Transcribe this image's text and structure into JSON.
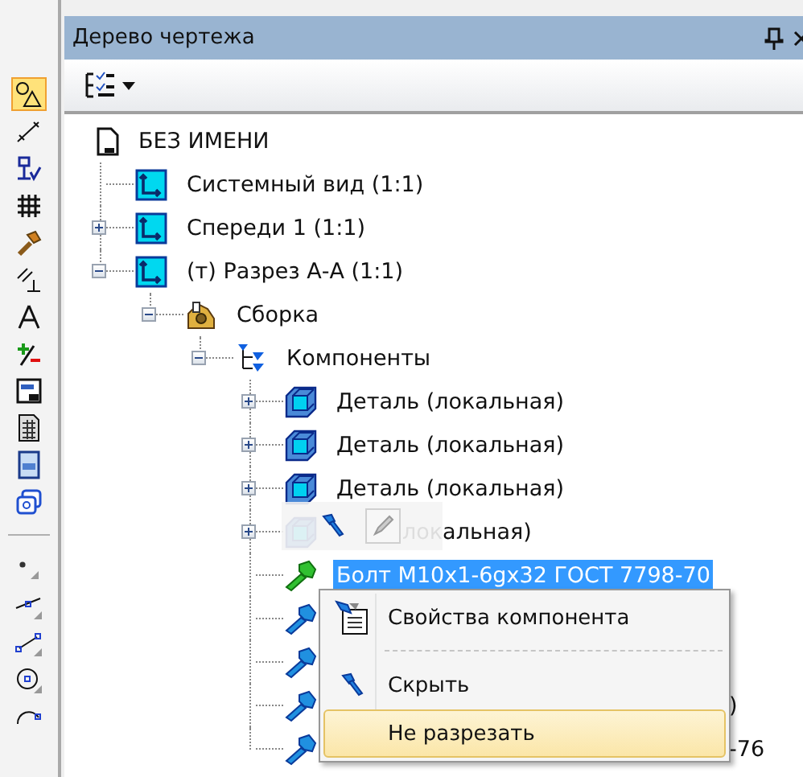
{
  "tools": [
    {
      "kind": "shapes",
      "selected": true
    },
    {
      "kind": "dimension",
      "selected": false
    },
    {
      "kind": "roughness",
      "selected": false
    },
    {
      "kind": "hatch",
      "selected": false
    },
    {
      "kind": "hammer",
      "selected": false
    },
    {
      "kind": "tolerance",
      "selected": false
    },
    {
      "kind": "compass",
      "selected": false
    },
    {
      "kind": "plusminus",
      "selected": false
    },
    {
      "kind": "frame",
      "selected": false
    },
    {
      "kind": "table",
      "selected": false
    },
    {
      "kind": "sheet",
      "selected": false
    },
    {
      "kind": "views",
      "selected": false
    },
    {
      "kind": "separator"
    },
    {
      "kind": "point",
      "selected": false
    },
    {
      "kind": "line",
      "selected": false
    },
    {
      "kind": "segment",
      "selected": false
    },
    {
      "kind": "circle",
      "selected": false
    },
    {
      "kind": "arc",
      "selected": false
    }
  ],
  "panel": {
    "title": "Дерево чертежа"
  },
  "tree": [
    {
      "kind": "drawing",
      "label": "БЕЗ ИМЕНИ",
      "selected": false,
      "children": [
        {
          "kind": "view",
          "label": "Системный вид (1:1)",
          "selected": false
        },
        {
          "kind": "view",
          "label": "Спереди 1 (1:1)",
          "selected": false,
          "expanded": false
        },
        {
          "kind": "view",
          "label": "(т) Разрез А-А (1:1)",
          "selected": false,
          "expanded": true,
          "children": [
            {
              "kind": "assembly",
              "label": "Сборка",
              "selected": false,
              "expanded": true,
              "children": [
                {
                  "kind": "components",
                  "label": "Компоненты",
                  "selected": false,
                  "expanded": true,
                  "children": [
                    {
                      "kind": "part",
                      "label": "Деталь (локальная)",
                      "selected": false,
                      "expanded": false
                    },
                    {
                      "kind": "part",
                      "label": "Деталь (локальная)",
                      "selected": false,
                      "expanded": false
                    },
                    {
                      "kind": "part",
                      "label": "Деталь (локальная)",
                      "selected": false,
                      "expanded": false
                    },
                    {
                      "kind": "part",
                      "label": "локальная)",
                      "selected": false,
                      "expanded": false,
                      "mini_toolbar": true
                    },
                    {
                      "kind": "bolt",
                      "label": "Болт M10x1-6gx32 ГОСТ 7798-70",
                      "selected": true
                    },
                    {
                      "kind": "bolt"
                    },
                    {
                      "kind": "bolt"
                    },
                    {
                      "kind": "bolt",
                      "label": ")",
                      "selected": false,
                      "covered": true
                    },
                    {
                      "kind": "bolt",
                      "label": "-76",
                      "selected": false,
                      "covered": true
                    }
                  ]
                }
              ]
            }
          ]
        }
      ]
    }
  ],
  "context_menu": [
    {
      "kind": "item",
      "label": "Свойства компонента",
      "highlighted": false
    },
    {
      "kind": "separator"
    },
    {
      "kind": "item",
      "label": "Скрыть",
      "highlighted": false
    },
    {
      "kind": "item",
      "label": "Не разрезать",
      "highlighted": true
    }
  ]
}
